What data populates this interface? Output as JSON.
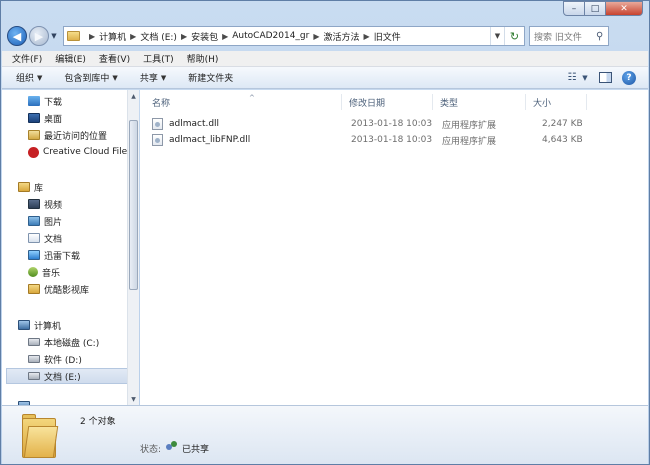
{
  "window": {
    "controls": {
      "minimize": "–",
      "maximize": "□",
      "close": "✕"
    }
  },
  "address": {
    "breadcrumbs": [
      "计算机",
      "文档 (E:)",
      "安装包",
      "AutoCAD2014_gr",
      "激活方法",
      "旧文件"
    ],
    "search_placeholder": "搜索 旧文件"
  },
  "menu": [
    "文件(F)",
    "编辑(E)",
    "查看(V)",
    "工具(T)",
    "帮助(H)"
  ],
  "toolbar": {
    "organize": "组织",
    "include_library": "包含到库中",
    "share": "共享",
    "new_folder": "新建文件夹"
  },
  "nav": {
    "favorites": [
      {
        "label": "下载",
        "icon": "download-icon"
      },
      {
        "label": "桌面",
        "icon": "desktop-icon"
      },
      {
        "label": "最近访问的位置",
        "icon": "recent-places-icon"
      },
      {
        "label": "Creative Cloud Files",
        "icon": "creative-cloud-icon"
      }
    ],
    "libraries_header": "库",
    "libraries": [
      {
        "label": "视频",
        "icon": "video-library-icon"
      },
      {
        "label": "图片",
        "icon": "picture-library-icon"
      },
      {
        "label": "文档",
        "icon": "document-library-icon"
      },
      {
        "label": "迅雷下载",
        "icon": "thunder-download-icon"
      },
      {
        "label": "音乐",
        "icon": "music-library-icon"
      },
      {
        "label": "优酷影视库",
        "icon": "youku-library-icon"
      }
    ],
    "computer_header": "计算机",
    "drives": [
      {
        "label": "本地磁盘 (C:)"
      },
      {
        "label": "软件 (D:)"
      },
      {
        "label": "文档 (E:)"
      }
    ]
  },
  "columns": {
    "name": "名称",
    "modified": "修改日期",
    "type": "类型",
    "size": "大小"
  },
  "files": [
    {
      "name": "adlmact.dll",
      "modified": "2013-01-18 10:03",
      "type": "应用程序扩展",
      "size": "2,247 KB"
    },
    {
      "name": "adlmact_libFNP.dll",
      "modified": "2013-01-18 10:03",
      "type": "应用程序扩展",
      "size": "4,643 KB"
    }
  ],
  "details": {
    "count": "2 个对象",
    "status_label": "状态:",
    "status_value": "已共享"
  }
}
